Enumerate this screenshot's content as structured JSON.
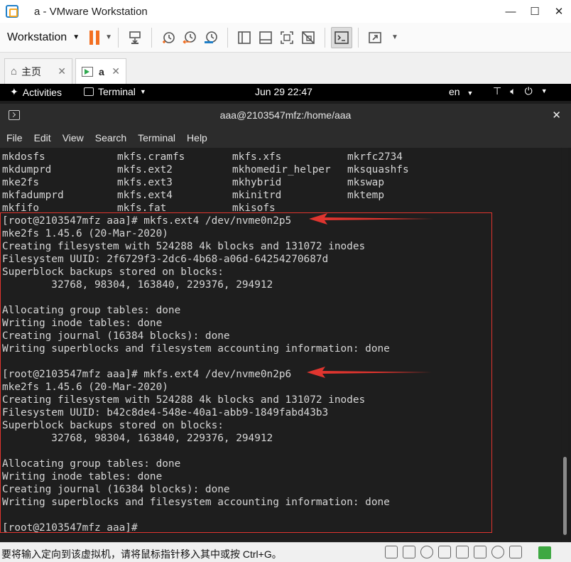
{
  "window": {
    "title": "a - VMware Workstation",
    "minimize": "—",
    "maximize": "☐",
    "close": "✕"
  },
  "toolbar": {
    "workstation_label": "Workstation"
  },
  "tabs": [
    {
      "label": "主页",
      "close": "✕"
    },
    {
      "label": "a",
      "close": "✕"
    }
  ],
  "gnome": {
    "activities": "Activities",
    "app": "Terminal",
    "clock": "Jun 29  22:47",
    "lang": "en"
  },
  "terminal": {
    "title": "aaa@2103547mfz:/home/aaa",
    "menu": [
      "File",
      "Edit",
      "View",
      "Search",
      "Terminal",
      "Help"
    ],
    "completion_rows": [
      [
        "mkdosfs",
        "mkfs.cramfs",
        "mkfs.xfs",
        "mkrfc2734"
      ],
      [
        "mkdumprd",
        "mkfs.ext2",
        "mkhomedir_helper",
        "mksquashfs"
      ],
      [
        "mke2fs",
        "mkfs.ext3",
        "mkhybrid",
        "mkswap"
      ],
      [
        "mkfadumprd",
        "mkfs.ext4",
        "mkinitrd",
        "mktemp"
      ],
      [
        "mkfifo",
        "mkfs.fat",
        "mkisofs",
        ""
      ]
    ],
    "lines": [
      "[root@2103547mfz aaa]# mkfs.ext4 /dev/nvme0n2p5",
      "mke2fs 1.45.6 (20-Mar-2020)",
      "Creating filesystem with 524288 4k blocks and 131072 inodes",
      "Filesystem UUID: 2f6729f3-2dc6-4b68-a06d-64254270687d",
      "Superblock backups stored on blocks:",
      "        32768, 98304, 163840, 229376, 294912",
      "",
      "Allocating group tables: done",
      "Writing inode tables: done",
      "Creating journal (16384 blocks): done",
      "Writing superblocks and filesystem accounting information: done",
      "",
      "[root@2103547mfz aaa]# mkfs.ext4 /dev/nvme0n2p6",
      "mke2fs 1.45.6 (20-Mar-2020)",
      "Creating filesystem with 524288 4k blocks and 131072 inodes",
      "Filesystem UUID: b42c8de4-548e-40a1-abb9-1849fabd43b3",
      "Superblock backups stored on blocks:",
      "        32768, 98304, 163840, 229376, 294912",
      "",
      "Allocating group tables: done",
      "Writing inode tables: done",
      "Creating journal (16384 blocks): done",
      "Writing superblocks and filesystem accounting information: done",
      "",
      "[root@2103547mfz aaa]#"
    ]
  },
  "statusbar": {
    "message": "要将输入定向到该虚拟机，请将鼠标指针移入其中或按 Ctrl+G。"
  },
  "colors": {
    "annotation_red": "#e0352f",
    "pause_orange": "#f36f21",
    "status_green": "#3ea842"
  }
}
